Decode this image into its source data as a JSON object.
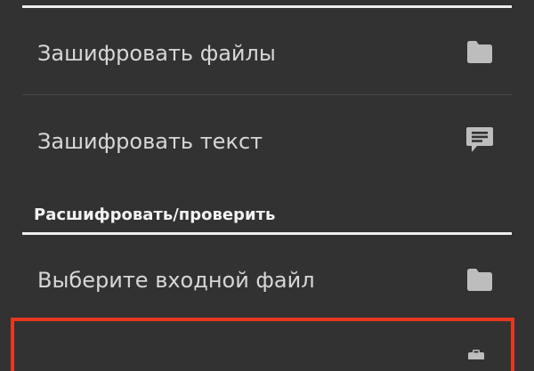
{
  "menu": {
    "items": [
      {
        "label": "Зашифровать файлы",
        "icon": "folder-icon"
      },
      {
        "label": "Зашифровать текст",
        "icon": "message-text-icon"
      }
    ],
    "section_title": "Расшифровать/проверить",
    "section_items": [
      {
        "label": "Выберите входной файл",
        "icon": "folder-icon"
      },
      {
        "label": "",
        "icon": "clipboard-icon"
      }
    ]
  },
  "colors": {
    "background": "#323232",
    "text": "#d7d7d7",
    "icon": "#bdbdbd",
    "divider": "#eeeeee",
    "highlight": "#e8381e"
  }
}
